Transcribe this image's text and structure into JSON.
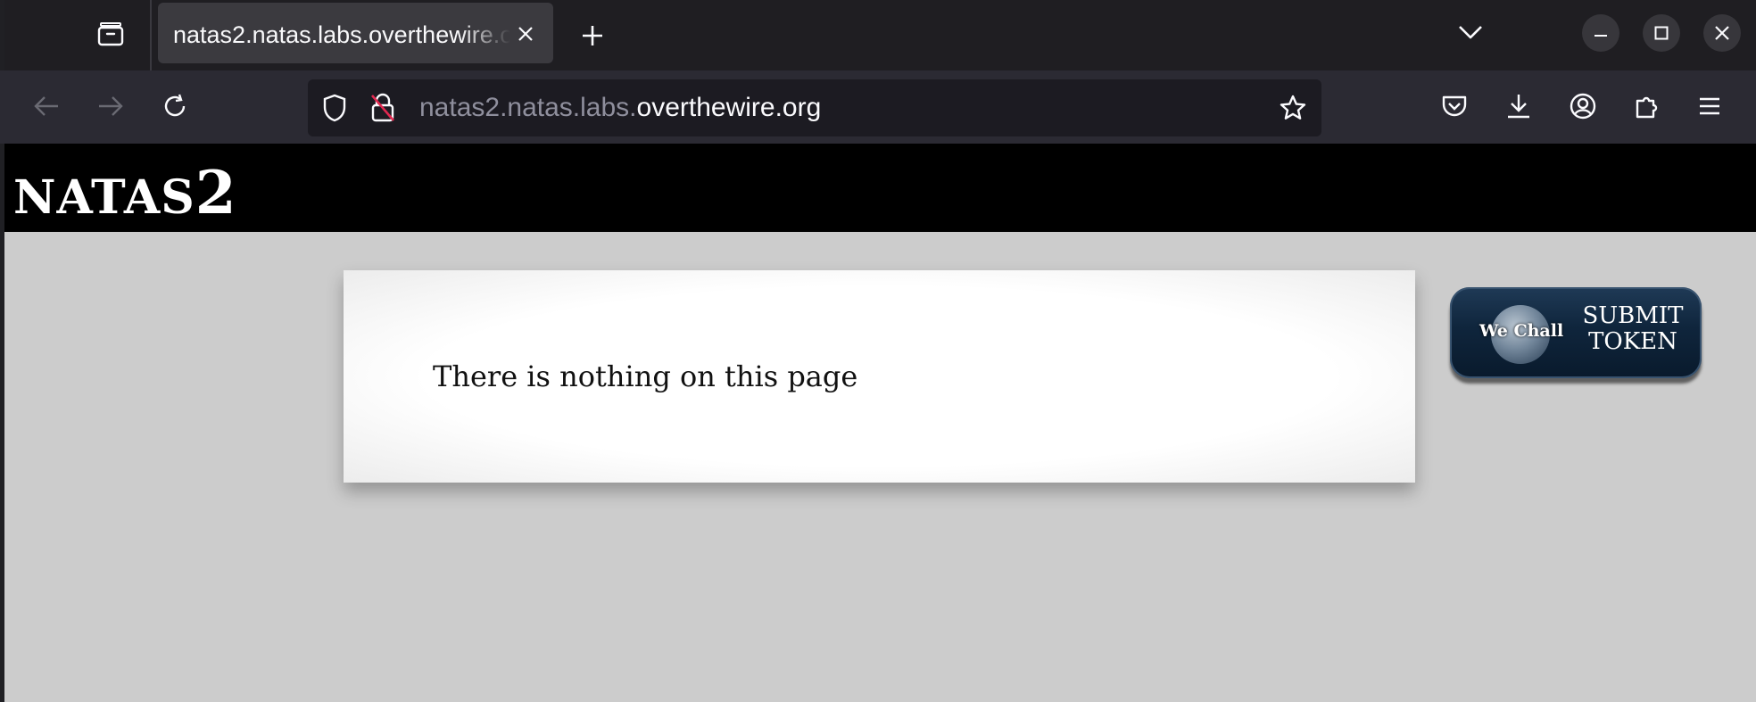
{
  "browser": {
    "tab_title": "natas2.natas.labs.overthewire.org",
    "url_prefix": "natas2.natas.labs.",
    "url_domain": "overthewire.org",
    "icons": {
      "tab_overview": "tab-overview-icon",
      "tab_close": "close-icon",
      "new_tab": "plus-icon",
      "tab_list": "chevron-down-icon",
      "minimize": "minimize-icon",
      "maximize": "maximize-icon",
      "close_window": "close-icon",
      "back": "arrow-left-icon",
      "forward": "arrow-right-icon",
      "reload": "reload-icon",
      "tracking": "shield-icon",
      "insecure": "insecure-lock-icon",
      "bookmark": "star-icon",
      "pocket": "pocket-icon",
      "downloads": "download-icon",
      "account": "account-icon",
      "extensions": "puzzle-icon",
      "menu": "hamburger-menu-icon"
    }
  },
  "page": {
    "site_title_small": "NATAS",
    "site_title_level": "2",
    "message": "There is nothing on this page",
    "wechall": {
      "brand": "We Chall",
      "action_line1": "SUBMIT",
      "action_line2": "TOKEN"
    }
  },
  "colors": {
    "chrome_dark": "#1f1e22",
    "navbar": "#2b2a33",
    "urlbar": "#1c1b22",
    "page_bg": "#cccccc",
    "header_bg": "#000000",
    "insecure_strike": "#e22850"
  }
}
